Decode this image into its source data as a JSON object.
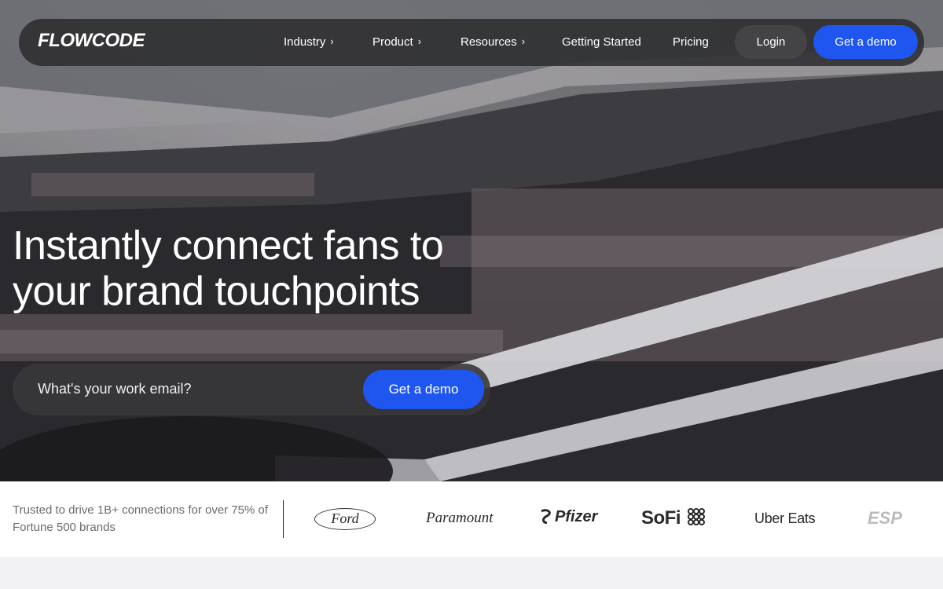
{
  "brand": {
    "logo_text": "FLOWCODE"
  },
  "nav": {
    "items": [
      {
        "label": "Industry",
        "has_dropdown": true
      },
      {
        "label": "Product",
        "has_dropdown": true
      },
      {
        "label": "Resources",
        "has_dropdown": true
      },
      {
        "label": "Getting Started",
        "has_dropdown": false
      },
      {
        "label": "Pricing",
        "has_dropdown": false
      }
    ],
    "chevron_glyph": "›",
    "login_label": "Login",
    "demo_label": "Get a demo"
  },
  "hero": {
    "headline_line1": "Instantly connect fans to",
    "headline_line2": "your brand touchpoints",
    "email_placeholder": "What's your work email?",
    "cta_label": "Get a demo"
  },
  "trust": {
    "text": "Trusted to drive 1B+ connections for over 75% of Fortune 500 brands",
    "logos": [
      "Ford",
      "Paramount",
      "Pfizer",
      "SoFi",
      "Uber Eats",
      "ESP"
    ]
  },
  "colors": {
    "accent": "#1f56f0",
    "nav_bg": "#2d2d30",
    "white": "#ffffff"
  },
  "icons": {
    "sofi_mark": "grid-dots-icon",
    "pfizer_mark": "pfizer-swirl-icon",
    "chevron": "chevron-right-icon"
  }
}
